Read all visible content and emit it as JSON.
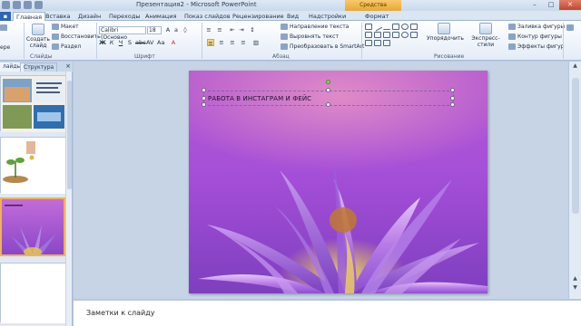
{
  "window": {
    "title": "Презентация2 - Microsoft PowerPoint",
    "contextual_tab": "Средства рисования"
  },
  "tabs": [
    "Главная",
    "Вставка",
    "Дизайн",
    "Переходы",
    "Анимация",
    "Показ слайдов",
    "Рецензирование",
    "Вид",
    "Надстройки",
    "Формат"
  ],
  "ribbon": {
    "create_slide": "Создать слайд",
    "layout": "Макет",
    "restore": "Восстановить",
    "section": "Раздел",
    "font_name": "Calibri (Основно",
    "font_size": "18",
    "groups": {
      "slides": "Слайды",
      "font": "Шрифт",
      "paragraph": "Абзац",
      "drawing": "Рисование"
    },
    "text_direction": "Направление текста",
    "align_text": "Выровнять текст",
    "convert_smartart": "Преобразовать в SmartArt",
    "arrange": "Упорядочить",
    "quick_styles": "Экспресс-стили",
    "shape_fill": "Заливка фигуры",
    "shape_outline": "Контур фигуры",
    "shape_effects": "Эффекты фигур",
    "clipboard_fragment": "ере"
  },
  "left_pane": {
    "tabs": [
      "лайды",
      "Структура"
    ],
    "close": "×"
  },
  "slide": {
    "title_text": "РАБОТА В ИНСТАГРАМ  И ФЕЙС"
  },
  "notes": {
    "placeholder": "Заметки к слайду"
  },
  "colors": {
    "accent": "#2f66b3",
    "contextual": "#f2b350",
    "slide_bg": "#a64fd8"
  }
}
